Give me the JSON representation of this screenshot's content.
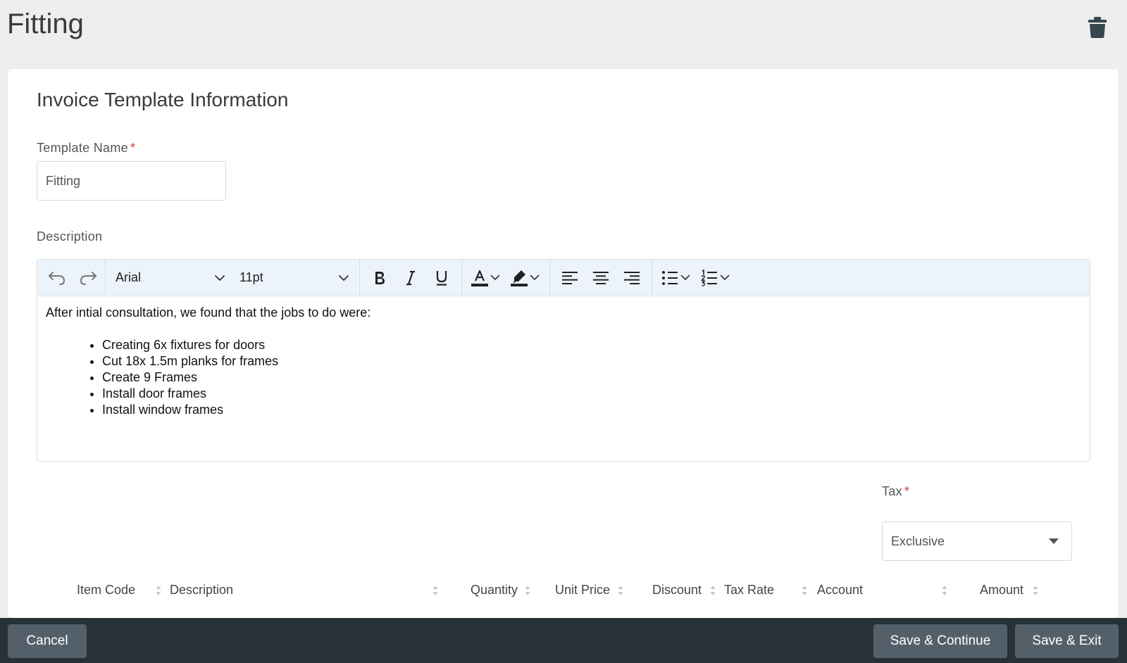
{
  "page": {
    "title": "Fitting"
  },
  "section": {
    "title": "Invoice Template Information"
  },
  "template_name": {
    "label": "Template Name",
    "required_mark": "*",
    "value": "Fitting"
  },
  "description": {
    "label": "Description",
    "toolbar": {
      "font_family": "Arial",
      "font_size": "11pt",
      "buttons": [
        "undo-icon",
        "redo-icon",
        "bold-icon",
        "italic-icon",
        "underline-icon",
        "text-color-icon",
        "highlight-icon",
        "align-left-icon",
        "align-center-icon",
        "align-right-icon",
        "bullet-list-icon",
        "numbered-list-icon"
      ]
    },
    "content": {
      "intro": "After intial consultation, we found that the jobs to do were:",
      "items": [
        "Creating 6x fixtures for doors",
        "Cut 18x 1.5m planks for frames",
        "Create 9 Frames",
        "Install door frames",
        "Install window frames"
      ]
    }
  },
  "tax": {
    "label": "Tax",
    "required_mark": "*",
    "value": "Exclusive"
  },
  "table": {
    "columns": [
      "Item Code",
      "Description",
      "Quantity",
      "Unit Price",
      "Discount",
      "Tax Rate",
      "Account",
      "Amount"
    ]
  },
  "footer": {
    "cancel": "Cancel",
    "save_continue": "Save & Continue",
    "save_exit": "Save & Exit"
  },
  "colors": {
    "background": "#eeeeee",
    "toolbar_bg": "#edf3fa",
    "footer_bg": "#263238",
    "footer_button": "#546069",
    "required": "#e53935"
  }
}
